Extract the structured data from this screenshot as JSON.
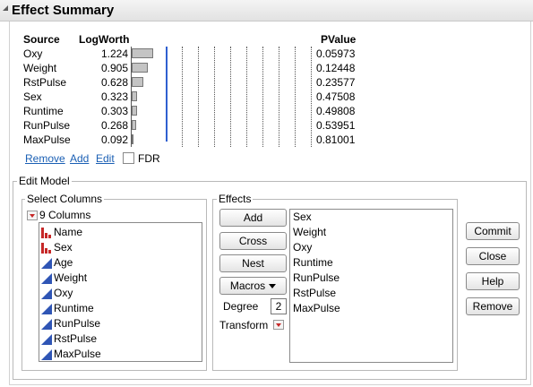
{
  "outline": {
    "title": "Effect Summary"
  },
  "summary": {
    "headers": {
      "source": "Source",
      "logworth": "LogWorth",
      "pvalue": "PValue"
    },
    "rows": [
      {
        "source": "Oxy",
        "logworth": "1.224",
        "pvalue": "0.05973",
        "value": 1.224
      },
      {
        "source": "Weight",
        "logworth": "0.905",
        "pvalue": "0.12448",
        "value": 0.905
      },
      {
        "source": "RstPulse",
        "logworth": "0.628",
        "pvalue": "0.23577",
        "value": 0.628
      },
      {
        "source": "Sex",
        "logworth": "0.323",
        "pvalue": "0.47508",
        "value": 0.323
      },
      {
        "source": "Runtime",
        "logworth": "0.303",
        "pvalue": "0.49808",
        "value": 0.303
      },
      {
        "source": "RunPulse",
        "logworth": "0.268",
        "pvalue": "0.53951",
        "value": 0.268
      },
      {
        "source": "MaxPulse",
        "logworth": "0.092",
        "pvalue": "0.81001",
        "value": 0.092
      }
    ],
    "links": {
      "remove": "Remove",
      "add": "Add",
      "edit": "Edit"
    },
    "fdr_label": "FDR",
    "fdr_checked": false
  },
  "edit_model": {
    "title": "Edit Model",
    "select_columns": {
      "title": "Select Columns",
      "count_label": "9 Columns",
      "columns": [
        {
          "name": "Name",
          "type": "nominal"
        },
        {
          "name": "Sex",
          "type": "nominal"
        },
        {
          "name": "Age",
          "type": "continuous"
        },
        {
          "name": "Weight",
          "type": "continuous"
        },
        {
          "name": "Oxy",
          "type": "continuous"
        },
        {
          "name": "Runtime",
          "type": "continuous"
        },
        {
          "name": "RunPulse",
          "type": "continuous"
        },
        {
          "name": "RstPulse",
          "type": "continuous"
        },
        {
          "name": "MaxPulse",
          "type": "continuous"
        }
      ]
    },
    "effects": {
      "title": "Effects",
      "buttons": {
        "add": "Add",
        "cross": "Cross",
        "nest": "Nest",
        "macros": "Macros"
      },
      "degree_label": "Degree",
      "degree_value": "2",
      "transform_label": "Transform",
      "items": [
        "Sex",
        "Weight",
        "Oxy",
        "Runtime",
        "RunPulse",
        "RstPulse",
        "MaxPulse"
      ]
    },
    "actions": {
      "commit": "Commit",
      "close": "Close",
      "help": "Help",
      "remove": "Remove"
    }
  },
  "colors": {
    "link": "#1a5fb4",
    "refline": "#2f5fd0",
    "nominal_icon": "#c62828",
    "continuous_icon": "#2f55b5"
  }
}
